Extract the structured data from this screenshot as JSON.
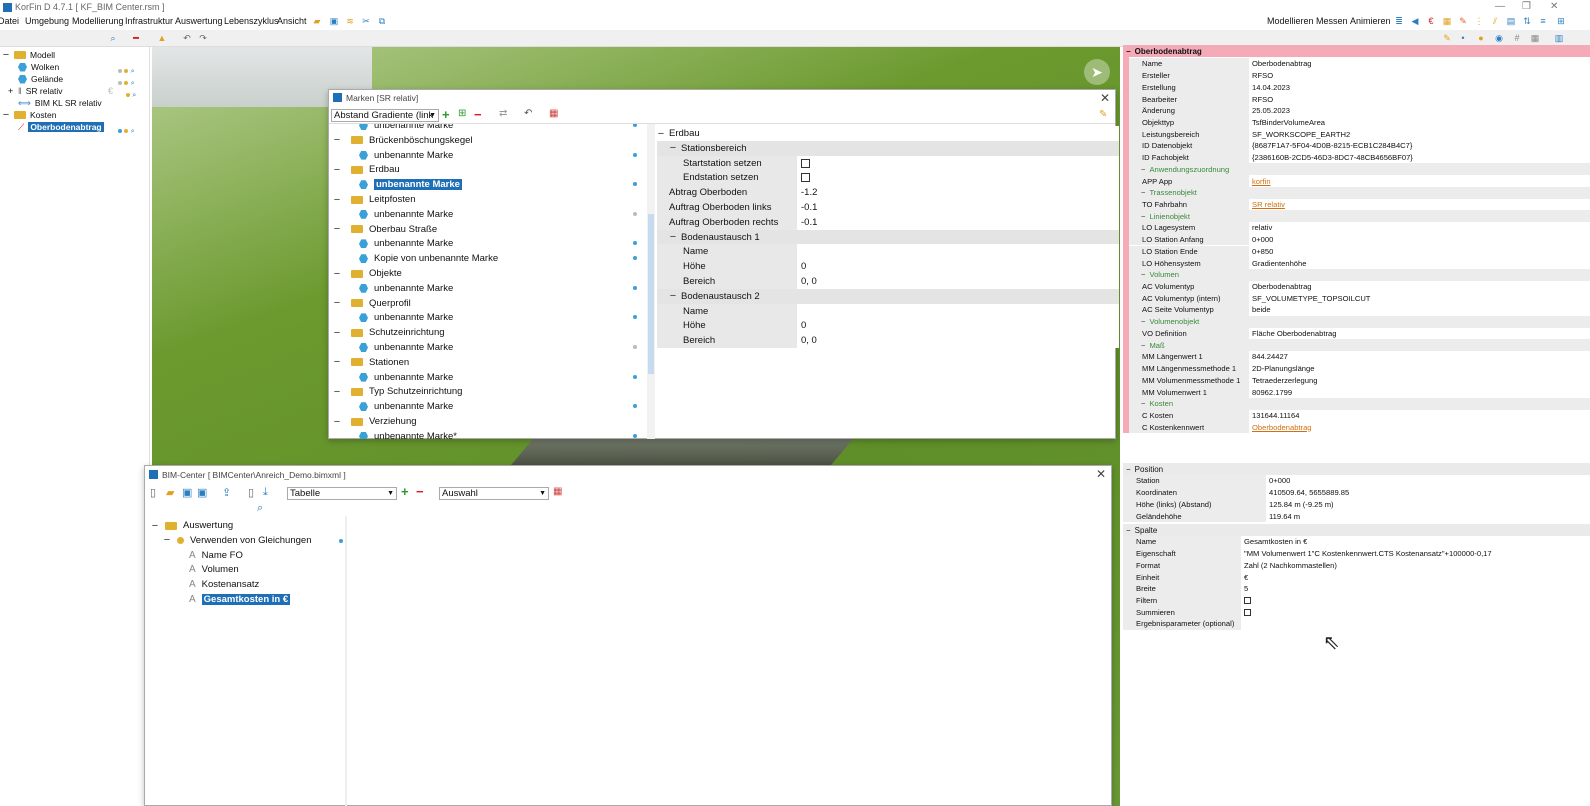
{
  "app": {
    "title": "KorFin D 4.7.1 [ KF_BIM Center.rsm ]"
  },
  "menu": [
    "Datei",
    "Umgebung",
    "Modellierung",
    "Infrastruktur",
    "Auswertung",
    "Lebenszyklus",
    "Ansicht"
  ],
  "menu_right": [
    "Modellieren",
    "Messen",
    "Animieren"
  ],
  "model_tree": [
    {
      "label": "Modell",
      "depth": 0,
      "icon": "folder-icon"
    },
    {
      "label": "Wolken",
      "depth": 1,
      "icon": "hex-icon"
    },
    {
      "label": "Gelände",
      "depth": 1,
      "icon": "hex-icon"
    },
    {
      "label": "SR relativ",
      "depth": 1,
      "icon": "axis-icon"
    },
    {
      "label": "BIM KL SR relativ",
      "depth": 1,
      "icon": "link-icon"
    },
    {
      "label": "Kosten",
      "depth": 0,
      "icon": "folder-icon"
    },
    {
      "label": "Oberbodenabtrag",
      "depth": 1,
      "icon": "chart-icon",
      "selected": true
    }
  ],
  "marken": {
    "title": "Marken [SR relativ]",
    "dropdown": "Abstand Gradiente (link",
    "tree": [
      {
        "label": "unbenannte Marke",
        "type": "item"
      },
      {
        "label": "Brückenböschungskegel",
        "type": "group"
      },
      {
        "label": "unbenannte Marke",
        "type": "item"
      },
      {
        "label": "Erdbau",
        "type": "group"
      },
      {
        "label": "unbenannte Marke",
        "type": "item",
        "selected": true
      },
      {
        "label": "Leitpfosten",
        "type": "group"
      },
      {
        "label": "unbenannte Marke",
        "type": "item"
      },
      {
        "label": "Oberbau Straße",
        "type": "group"
      },
      {
        "label": "unbenannte Marke",
        "type": "item"
      },
      {
        "label": "Kopie von unbenannte Marke",
        "type": "item"
      },
      {
        "label": "Objekte",
        "type": "group"
      },
      {
        "label": "unbenannte Marke",
        "type": "item"
      },
      {
        "label": "Querprofil",
        "type": "group"
      },
      {
        "label": "unbenannte Marke",
        "type": "item"
      },
      {
        "label": "Schutzeinrichtung",
        "type": "group"
      },
      {
        "label": "unbenannte Marke",
        "type": "item"
      },
      {
        "label": "Stationen",
        "type": "group"
      },
      {
        "label": "unbenannte Marke",
        "type": "item"
      },
      {
        "label": "Typ Schutzeinrichtung",
        "type": "group"
      },
      {
        "label": "unbenannte Marke",
        "type": "item"
      },
      {
        "label": "Verziehung",
        "type": "group"
      },
      {
        "label": "unbenannte Marke*",
        "type": "item"
      }
    ],
    "props": [
      {
        "label": "Erdbau",
        "kind": "root"
      },
      {
        "label": "Stationsbereich",
        "kind": "section"
      },
      {
        "label": "Startstation setzen",
        "kind": "check",
        "value": ""
      },
      {
        "label": "Endstation setzen",
        "kind": "check",
        "value": ""
      },
      {
        "label": "Abtrag Oberboden",
        "kind": "prop",
        "value": "-1.2"
      },
      {
        "label": "Auftrag Oberboden links",
        "kind": "prop",
        "value": "-0.1"
      },
      {
        "label": "Auftrag Oberboden rechts",
        "kind": "prop",
        "value": "-0.1"
      },
      {
        "label": "Bodenaustausch 1",
        "kind": "section"
      },
      {
        "label": "Name",
        "kind": "sub",
        "value": ""
      },
      {
        "label": "Höhe",
        "kind": "sub",
        "value": "0"
      },
      {
        "label": "Bereich",
        "kind": "sub",
        "value": "0, 0"
      },
      {
        "label": "Bodenaustausch 2",
        "kind": "section"
      },
      {
        "label": "Name",
        "kind": "sub",
        "value": ""
      },
      {
        "label": "Höhe",
        "kind": "sub",
        "value": "0"
      },
      {
        "label": "Bereich",
        "kind": "sub",
        "value": "0, 0"
      }
    ]
  },
  "bimcenter": {
    "title": "BIM-Center [ BIMCenter\\Anreich_Demo.bimxml ]",
    "dropdown1": "Tabelle",
    "dropdown2": "Auswahl",
    "tree": [
      {
        "label": "Auswertung",
        "depth": 0,
        "icon": "folder-icon"
      },
      {
        "label": "Verwenden von Gleichungen",
        "depth": 1,
        "icon": "dot-icon"
      },
      {
        "label": "Name FO",
        "depth": 2,
        "icon": "text-icon"
      },
      {
        "label": "Volumen",
        "depth": 2,
        "icon": "text-icon"
      },
      {
        "label": "Kostenansatz",
        "depth": 2,
        "icon": "text-icon"
      },
      {
        "label": "Gesamtkosten in €",
        "depth": 2,
        "icon": "text-icon",
        "selected": true
      }
    ]
  },
  "props_right": {
    "header": "Oberbodenabtrag",
    "rows": [
      {
        "l": "Name",
        "v": "Oberbodenabtrag"
      },
      {
        "l": "Ersteller",
        "v": "RFSO"
      },
      {
        "l": "Erstellung",
        "v": "14.04.2023"
      },
      {
        "l": "Bearbeiter",
        "v": "RFSO"
      },
      {
        "l": "Änderung",
        "v": "25.05.2023"
      },
      {
        "l": "Objekttyp",
        "v": "TsfBinderVolumeArea"
      },
      {
        "l": "Leistungsbereich",
        "v": "SF_WORKSCOPE_EARTH2"
      },
      {
        "l": "ID Datenobjekt",
        "v": "{8687F1A7-5F04-4D0B-8215-ECB1C284B4C7}"
      },
      {
        "l": "ID Fachobjekt",
        "v": "{2386160B-2CD5-46D3-8DC7-48CB4656BF07}"
      },
      {
        "l": "Anwendungszuordnung",
        "sec": true
      },
      {
        "l": "APP App",
        "v": "korfin",
        "link": true
      },
      {
        "l": "Trassenobjekt",
        "sec": true
      },
      {
        "l": "TO Fahrbahn",
        "v": "SR relativ",
        "link": true
      },
      {
        "l": "Linienobjekt",
        "sec": true
      },
      {
        "l": "LO Lagesystem",
        "v": "relativ"
      },
      {
        "l": "LO Station Anfang",
        "v": "0+000"
      },
      {
        "l": "LO Station Ende",
        "v": "0+850"
      },
      {
        "l": "LO Höhensystem",
        "v": "Gradientenhöhe"
      },
      {
        "l": "Volumen",
        "sec": true
      },
      {
        "l": "AC Volumentyp",
        "v": "Oberbodenabtrag"
      },
      {
        "l": "AC Volumentyp (intern)",
        "v": "SF_VOLUMETYPE_TOPSOILCUT"
      },
      {
        "l": "AC Seite Volumentyp",
        "v": "beide"
      },
      {
        "l": "Volumenobjekt",
        "sec": true
      },
      {
        "l": "VO Definition",
        "v": "Fläche Oberbodenabtrag"
      },
      {
        "l": "Maß",
        "sec": true
      },
      {
        "l": "MM Längenwert 1",
        "v": "844.24427"
      },
      {
        "l": "MM Längenmessmethode 1",
        "v": "2D-Planungslänge"
      },
      {
        "l": "MM Volumenmessmethode 1",
        "v": "Tetraederzerlegung"
      },
      {
        "l": "MM Volumenwert 1",
        "v": "80962.1799"
      },
      {
        "l": "Kosten",
        "sec": true
      },
      {
        "l": "C Kosten",
        "v": "131644.11164"
      },
      {
        "l": "C Kostenkennwert",
        "v": "Oberbodenabtrag",
        "link": true
      }
    ]
  },
  "position": {
    "header": "Position",
    "rows": [
      {
        "l": "Station",
        "v": "0+000"
      },
      {
        "l": "Koordinaten",
        "v": "410509.64, 5655889.85"
      },
      {
        "l": "Höhe (links) (Abstand)",
        "v": "125.84 m (-9.25 m)"
      },
      {
        "l": "Geländehöhe",
        "v": "119.64 m"
      }
    ]
  },
  "spalte": {
    "header": "Spalte",
    "rows": [
      {
        "l": "Name",
        "v": "Gesamtkosten in €"
      },
      {
        "l": "Eigenschaft",
        "v": "\"MM Volumenwert 1\"C Kostenkennwert.CTS Kostenansatz\"+100000-0,17"
      },
      {
        "l": "Format",
        "v": "Zahl (2 Nachkommastellen)"
      },
      {
        "l": "Einheit",
        "v": "€"
      },
      {
        "l": "Breite",
        "v": "5"
      },
      {
        "l": "Filtern",
        "v": "",
        "check": true
      },
      {
        "l": "Summieren",
        "v": "",
        "check": true
      },
      {
        "l": "Ergebnisparameter (optional)",
        "v": ""
      }
    ]
  }
}
